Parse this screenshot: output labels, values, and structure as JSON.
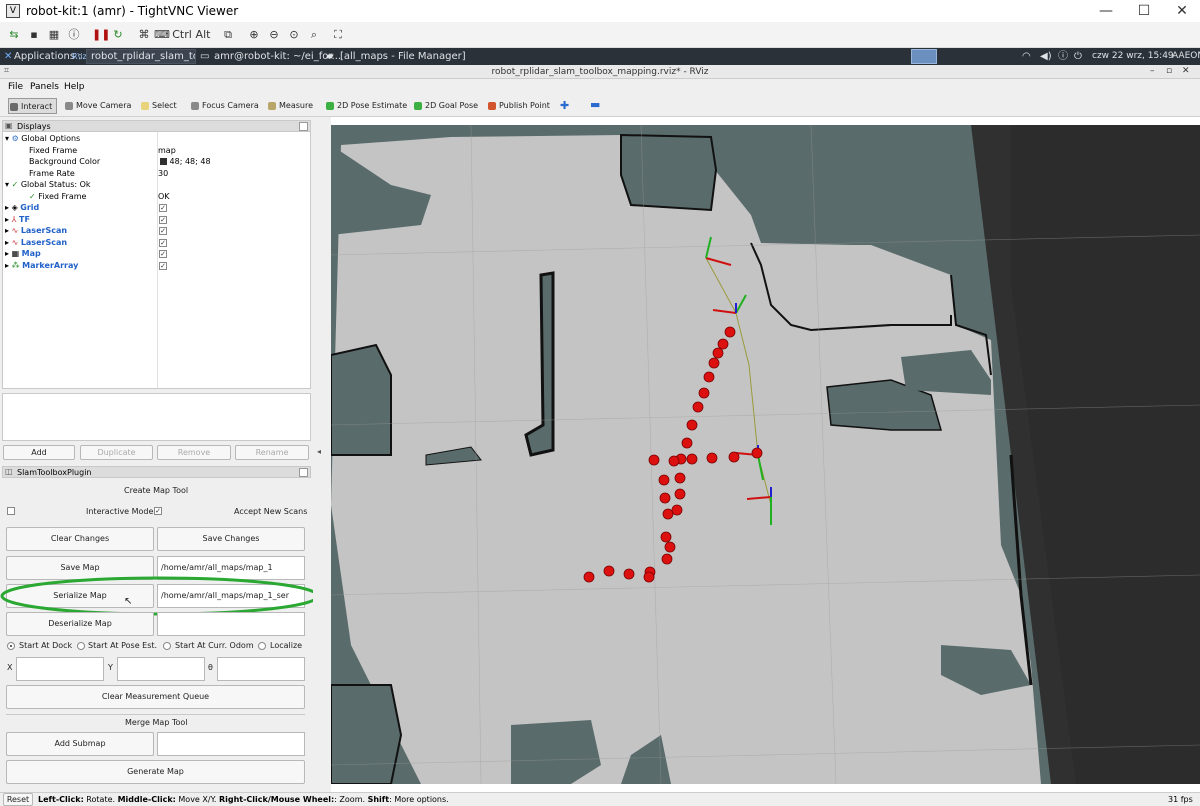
{
  "vnc": {
    "title": "robot-kit:1 (amr) - TightVNC Viewer",
    "toolbar_ctrl": "Ctrl",
    "toolbar_alt": "Alt",
    "minimize": "—",
    "maximize": "☐",
    "close": "✕"
  },
  "panel": {
    "applications": "Applications :",
    "rviz_tag": "R\\iz",
    "task1": "robot_rplidar_slam_tool...",
    "task2": "amr@robot-kit: ~/ei_for...",
    "task3": "[all_maps - File Manager]",
    "clock": "czw 22 wrz, 15:49",
    "host": "AAEON"
  },
  "rviz": {
    "window_title": "robot_rplidar_slam_toolbox_mapping.rviz* - RViz",
    "menu": [
      "File",
      "Panels",
      "Help"
    ],
    "tools": [
      {
        "label": "Interact",
        "color": "#6a6a6a",
        "active": true
      },
      {
        "label": "Move Camera",
        "color": "#8a8a8a"
      },
      {
        "label": "Select",
        "color": "#e9d37a"
      },
      {
        "label": "Focus Camera",
        "color": "#8a8a8a"
      },
      {
        "label": "Measure",
        "color": "#b9a46a"
      },
      {
        "label": "2D Pose Estimate",
        "color": "#3cb043"
      },
      {
        "label": "2D Goal Pose",
        "color": "#3cb043"
      },
      {
        "label": "Publish Point",
        "color": "#d2542c"
      }
    ]
  },
  "displays": {
    "header": "Displays",
    "global_options": "Global Options",
    "fixed_frame_label": "Fixed Frame",
    "fixed_frame_value": "map",
    "bg_color_label": "Background Color",
    "bg_color_value": "48; 48; 48",
    "frame_rate_label": "Frame Rate",
    "frame_rate_value": "30",
    "global_status": "Global Status: Ok",
    "status_fixed_frame": "Fixed Frame",
    "status_fixed_frame_value": "OK",
    "items": [
      "Grid",
      "TF",
      "LaserScan",
      "LaserScan",
      "Map",
      "MarkerArray"
    ],
    "btn_add": "Add",
    "btn_duplicate": "Duplicate",
    "btn_remove": "Remove",
    "btn_rename": "Rename"
  },
  "slam": {
    "header": "SlamToolboxPlugin",
    "create_title": "Create Map Tool",
    "interactive_mode": "Interactive Mode",
    "accept_new_scans": "Accept New Scans",
    "clear_changes": "Clear Changes",
    "save_changes": "Save Changes",
    "save_map": "Save Map",
    "save_map_path": "/home/amr/all_maps/map_1",
    "serialize_map": "Serialize Map",
    "serialize_path": "/home/amr/all_maps/map_1_ser",
    "deserialize_map": "Deserialize Map",
    "start_dock": "Start At Dock",
    "start_pose": "Start At Pose Est.",
    "start_odom": "Start At Curr. Odom",
    "localize": "Localize",
    "x": "X",
    "y": "Y",
    "theta": "θ",
    "clear_queue": "Clear Measurement Queue",
    "merge_title": "Merge Map Tool",
    "add_submap": "Add Submap",
    "generate_map": "Generate Map"
  },
  "status": {
    "reset": "Reset",
    "hint_b1": "Left-Click:",
    "hint_t1": " Rotate. ",
    "hint_b2": "Middle-Click:",
    "hint_t2": " Move X/Y. ",
    "hint_b3": "Right-Click/Mouse Wheel:",
    "hint_t3": ": Zoom. ",
    "hint_b4": "Shift",
    "hint_t4": ": More options.",
    "fps": "31 fps"
  },
  "colors": {
    "map_free": "#c4c4c4",
    "map_unknown": "#5a6b6b",
    "background": "#303030",
    "marker": "#dd1010",
    "highlight": "#2aa832"
  }
}
